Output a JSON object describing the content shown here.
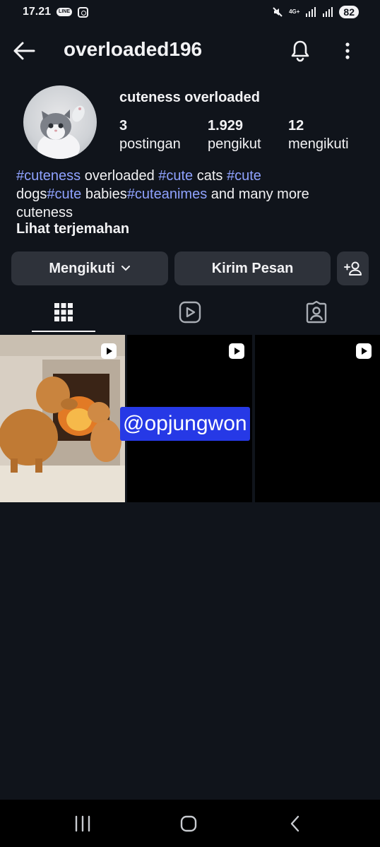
{
  "status_bar": {
    "time": "17.21",
    "line_badge": "LINE",
    "network": "4G+",
    "battery": "82"
  },
  "header": {
    "username": "overloaded196"
  },
  "profile": {
    "display_name": "cuteness overloaded",
    "stats": [
      {
        "value": "3",
        "label": "postingan"
      },
      {
        "value": "1.929",
        "label": "pengikut"
      },
      {
        "value": "12",
        "label": "mengikuti"
      }
    ],
    "bio": {
      "line1": [
        {
          "text": "#cuteness",
          "tag": true
        },
        {
          "text": " overloaded ",
          "tag": false
        },
        {
          "text": "#cute",
          "tag": true
        },
        {
          "text": " cats ",
          "tag": false
        },
        {
          "text": "#cute",
          "tag": true
        }
      ],
      "line2": [
        {
          "text": "dogs",
          "tag": false
        },
        {
          "text": "#cute",
          "tag": true
        },
        {
          "text": " babies",
          "tag": false
        },
        {
          "text": "#cuteanimes",
          "tag": true
        },
        {
          "text": " and many more",
          "tag": false
        }
      ],
      "line3": [
        {
          "text": "cuteness",
          "tag": false
        }
      ]
    },
    "translate_link": "Lihat terjemahan"
  },
  "actions": {
    "following_label": "Mengikuti",
    "message_label": "Kirim Pesan"
  },
  "tabs": [
    {
      "icon": "grid-icon",
      "active": true
    },
    {
      "icon": "reels-icon",
      "active": false
    },
    {
      "icon": "tagged-icon",
      "active": false
    }
  ],
  "watermark": "@opjungwon",
  "colors": {
    "background": "#10141b",
    "button": "#2e323a",
    "hashtag": "#8fa2ff",
    "watermark_bg": "#2639e6"
  }
}
